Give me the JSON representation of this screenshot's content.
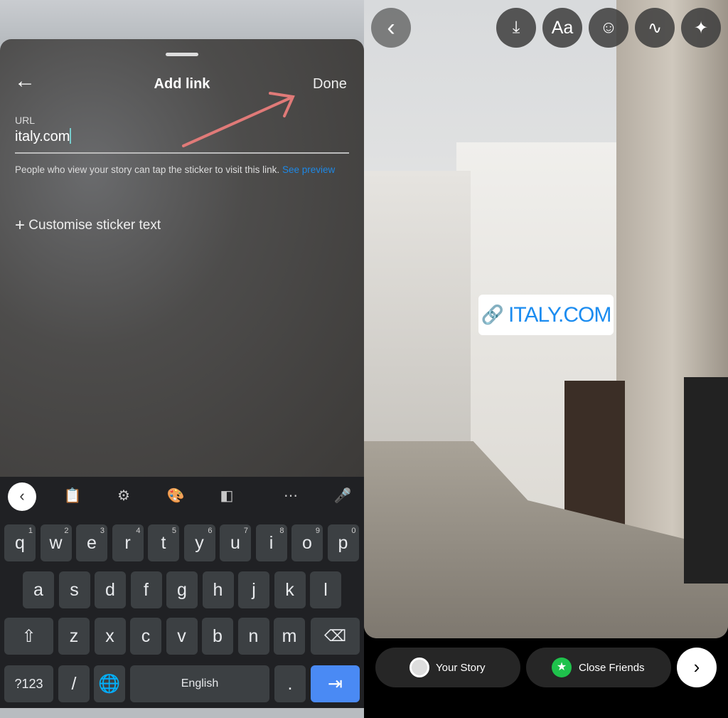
{
  "link_sheet": {
    "title": "Add link",
    "done": "Done",
    "url_label": "URL",
    "url_value": "italy.com",
    "helper": "People who view your story can tap the sticker to visit this link.",
    "helper_link": "See preview",
    "customise": "Customise sticker text"
  },
  "keyboard": {
    "row1": [
      [
        "q",
        "1"
      ],
      [
        "w",
        "2"
      ],
      [
        "e",
        "3"
      ],
      [
        "r",
        "4"
      ],
      [
        "t",
        "5"
      ],
      [
        "y",
        "6"
      ],
      [
        "u",
        "7"
      ],
      [
        "i",
        "8"
      ],
      [
        "o",
        "9"
      ],
      [
        "p",
        "0"
      ]
    ],
    "row2": [
      "a",
      "s",
      "d",
      "f",
      "g",
      "h",
      "j",
      "k",
      "l"
    ],
    "row3": [
      "z",
      "x",
      "c",
      "v",
      "b",
      "n",
      "m"
    ],
    "symbols": "?123",
    "slash": "/",
    "space": "English",
    "period": ".",
    "accent": "#4a8af4"
  },
  "story": {
    "sticker_text": "ITALY.COM",
    "sticker_color": "#1b8cf0",
    "your_story": "Your Story",
    "close_friends": "Close Friends",
    "close_friends_color": "#1fc24c",
    "tools": [
      "download-icon",
      "text-icon",
      "sticker-icon",
      "draw-icon",
      "effects-icon"
    ],
    "text_tool_label": "Aa"
  },
  "annotation_color": "#e07a78"
}
